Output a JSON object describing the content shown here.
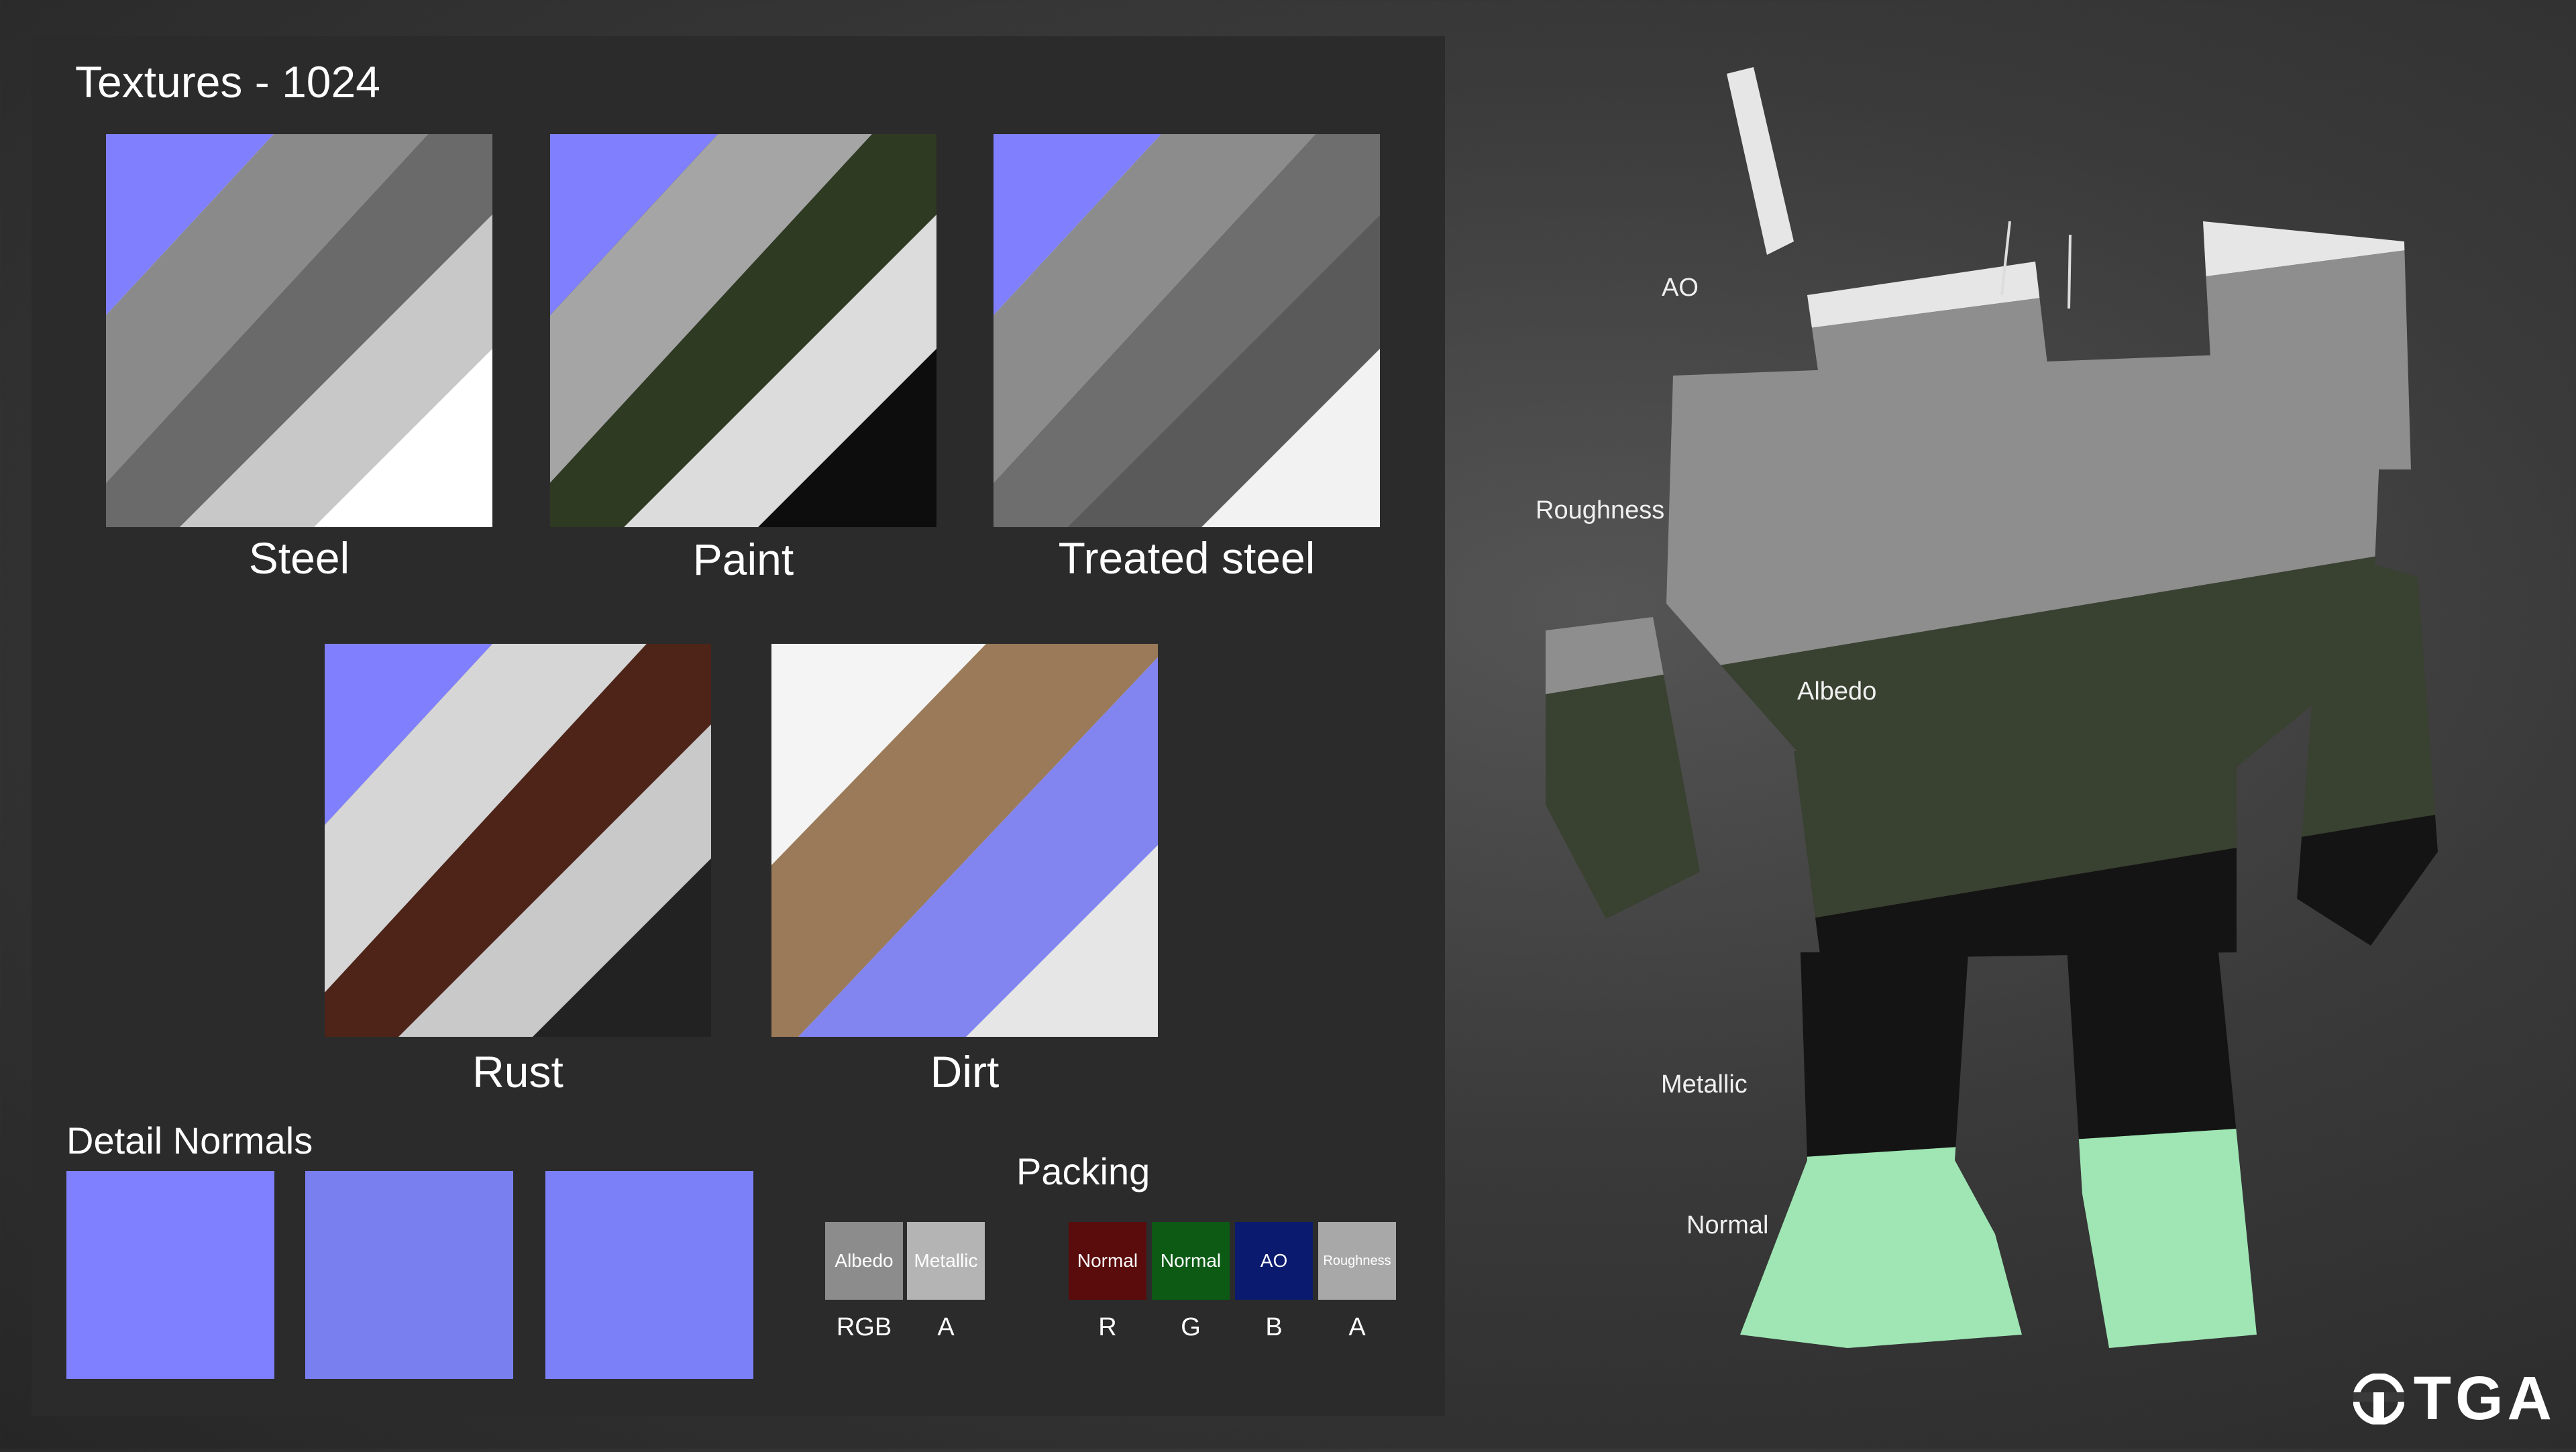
{
  "panel": {
    "title": "Textures - 1024"
  },
  "textures": [
    {
      "label": "Steel",
      "colors": [
        "#8080ff",
        "#8a8a8a",
        "#6a6a6a",
        "#c8c8c8",
        "#ffffff"
      ]
    },
    {
      "label": "Paint",
      "colors": [
        "#8080ff",
        "#a5a5a5",
        "#2e3a22",
        "#dcdcdc",
        "#0d0d0d"
      ]
    },
    {
      "label": "Treated steel",
      "colors": [
        "#8080ff",
        "#8c8c8c",
        "#6e6e6e",
        "#5a5a5a",
        "#f2f2f2"
      ]
    },
    {
      "label": "Rust",
      "colors": [
        "#8080ff",
        "#d6d6d6",
        "#4e2418",
        "#c9c9c9",
        "#222222"
      ]
    },
    {
      "label": "Dirt",
      "colors": [
        "#f4f4f4",
        "#9a7a58",
        "#8284f0",
        "#e6e6e6"
      ]
    }
  ],
  "detail_normals": {
    "title": "Detail Normals",
    "colors": [
      "#7f80ff",
      "#7a7ff0",
      "#7c80f8"
    ]
  },
  "packing": {
    "title": "Packing",
    "group1": [
      {
        "label": "Albedo",
        "color": "#8c8c8c",
        "channel": "RGB"
      },
      {
        "label": "Metallic",
        "color": "#b4b4b4",
        "channel": "A"
      }
    ],
    "group2": [
      {
        "label": "Normal",
        "color": "#5a0b0b",
        "channel": "R"
      },
      {
        "label": "Normal",
        "color": "#0c5a14",
        "channel": "G"
      },
      {
        "label": "AO",
        "color": "#0a1a6e",
        "channel": "B"
      },
      {
        "label": "Roughness",
        "color": "#a8a8a8",
        "channel": "A"
      }
    ]
  },
  "viewport": {
    "callouts": [
      "AO",
      "Roughness",
      "Albedo",
      "Metallic",
      "Normal"
    ]
  },
  "logo": {
    "text": "TGA"
  }
}
